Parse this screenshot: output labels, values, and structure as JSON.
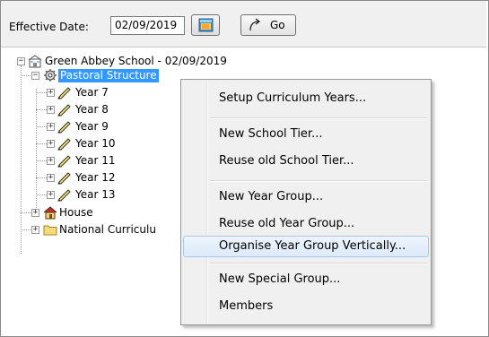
{
  "toolbar": {
    "effective_date_label": "Effective Date:",
    "effective_date_value": "02/09/2019",
    "calendar_icon": "calendar-icon",
    "go_label": "Go",
    "go_icon": "redo-arrow-icon"
  },
  "tree": {
    "root": {
      "label": "Green Abbey School - 02/09/2019",
      "icon": "school-building-icon"
    },
    "pastoral": {
      "label": "Pastoral Structure",
      "icon": "pastoral-gear-icon",
      "selected": true
    },
    "years": [
      {
        "label": "Year  7"
      },
      {
        "label": "Year  8"
      },
      {
        "label": "Year  9"
      },
      {
        "label": "Year 10"
      },
      {
        "label": "Year 11"
      },
      {
        "label": "Year 12"
      },
      {
        "label": "Year 13"
      }
    ],
    "house": {
      "label": "House",
      "icon": "house-icon"
    },
    "national": {
      "label": "National Curriculu",
      "icon": "folder-icon"
    }
  },
  "context_menu": {
    "items": [
      {
        "label": "Setup Curriculum Years..."
      },
      {
        "label": "New School Tier..."
      },
      {
        "label": "Reuse old School Tier..."
      },
      {
        "label": "New Year Group..."
      },
      {
        "label": "Reuse old Year Group..."
      },
      {
        "label": "Organise Year Group Vertically...",
        "hovered": true
      },
      {
        "label": "New Special Group..."
      },
      {
        "label": "Members"
      }
    ]
  },
  "colors": {
    "selection": "#3399ff",
    "menu_background": "#f0f0f0",
    "menu_hover": "#dceafb"
  }
}
